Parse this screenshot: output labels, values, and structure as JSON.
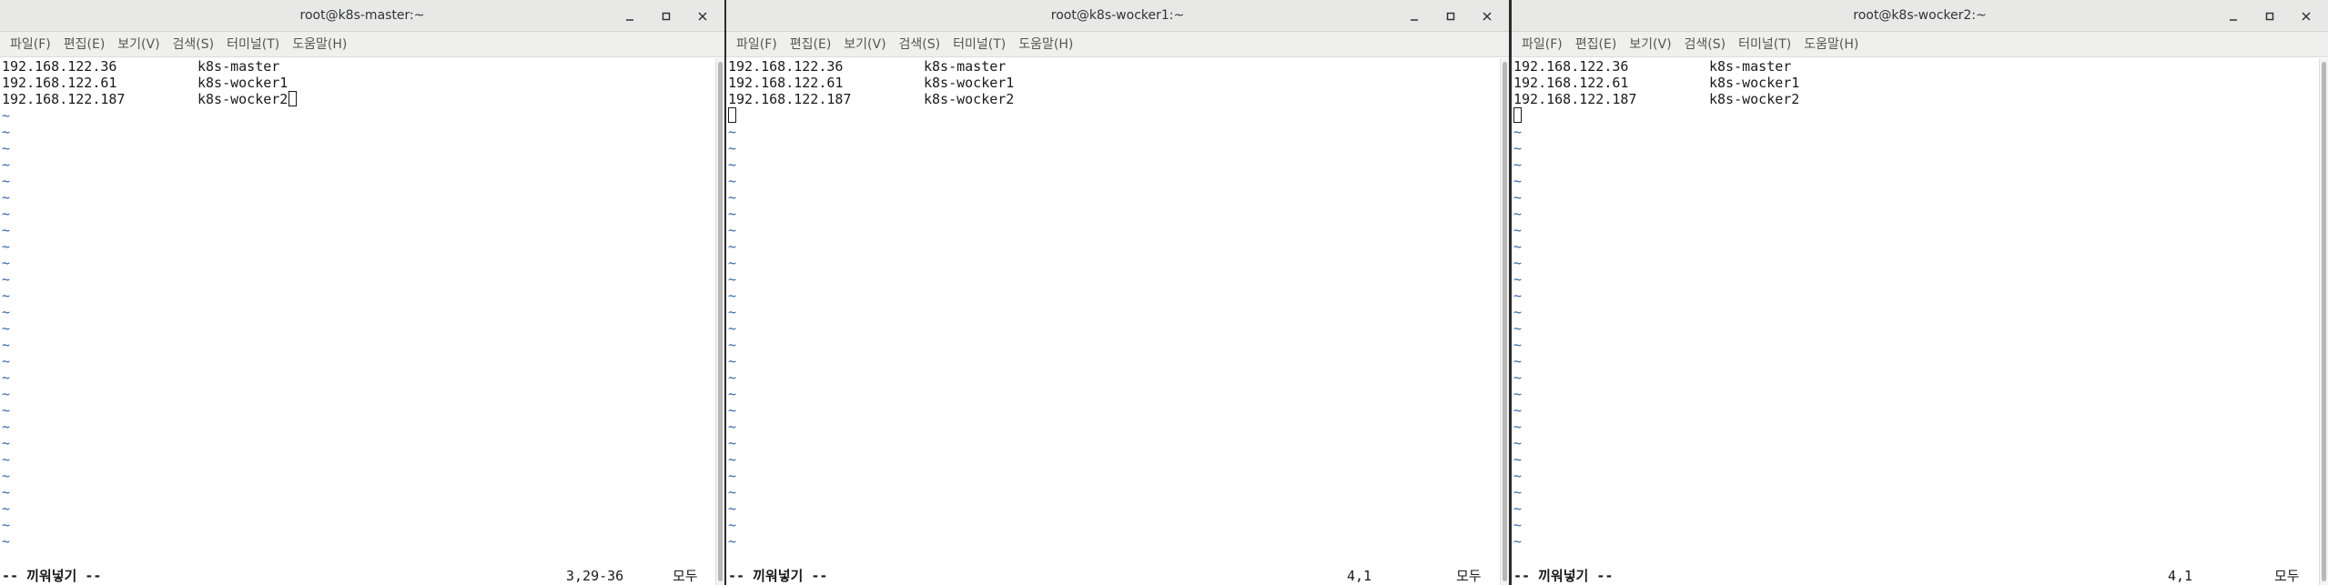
{
  "menu": [
    "파일(F)",
    "편집(E)",
    "보기(V)",
    "검색(S)",
    "터미널(T)",
    "도움말(H)"
  ],
  "hosts": [
    {
      "ip": "192.168.122.36",
      "name": "k8s-master"
    },
    {
      "ip": "192.168.122.61",
      "name": "k8s-wocker1"
    },
    {
      "ip": "192.168.122.187",
      "name": "k8s-wocker2"
    }
  ],
  "tilde": "~",
  "mode_label": "-- 끼워넣기 --",
  "all_label": "모두",
  "windows": [
    {
      "title": "root@k8s-master:~",
      "position": "3,29-36",
      "cursor_on_line": 3
    },
    {
      "title": "root@k8s-wocker1:~",
      "position": "4,1",
      "cursor_on_line": 4
    },
    {
      "title": "root@k8s-wocker2:~",
      "position": "4,1",
      "cursor_on_line": 4
    }
  ]
}
